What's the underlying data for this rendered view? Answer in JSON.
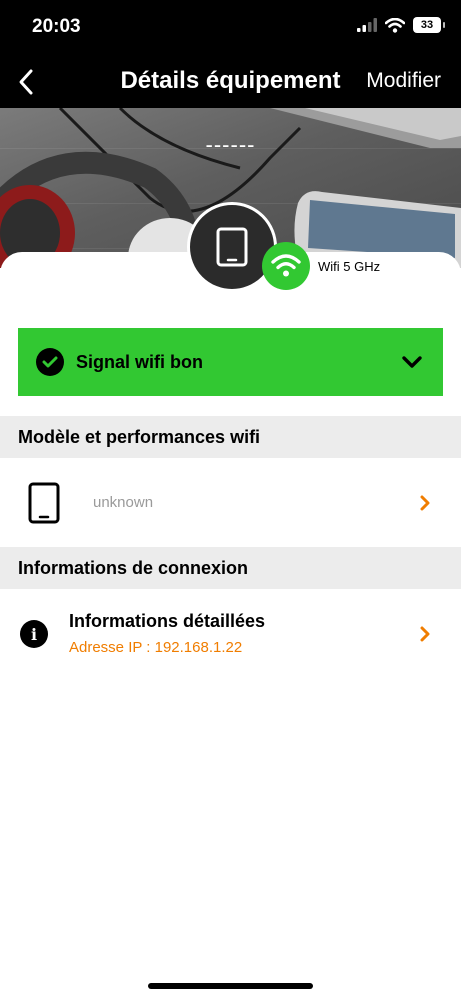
{
  "status_bar": {
    "time": "20:03",
    "battery": "33"
  },
  "nav": {
    "title": "Détails équipement",
    "edit_label": "Modifier"
  },
  "device": {
    "name": "------",
    "wifi_band": "Wifi 5 GHz"
  },
  "signal": {
    "label": "Signal wifi bon",
    "color": "#32c832"
  },
  "sections": {
    "model": {
      "header": "Modèle et performances wifi",
      "model_value": "unknown"
    },
    "connection": {
      "header": "Informations de connexion",
      "title": "Informations détaillées",
      "subtitle": "Adresse IP : 192.168.1.22"
    }
  },
  "colors": {
    "accent": "#f07d00",
    "success": "#32c832",
    "section_bg": "#ececec"
  },
  "icons": {
    "back": "chevron-left-icon",
    "tablet": "tablet-icon",
    "wifi": "wifi-icon",
    "check": "check-circle-icon",
    "expand": "chevron-down-icon",
    "info": "info-icon",
    "navigate": "chevron-right-icon"
  }
}
